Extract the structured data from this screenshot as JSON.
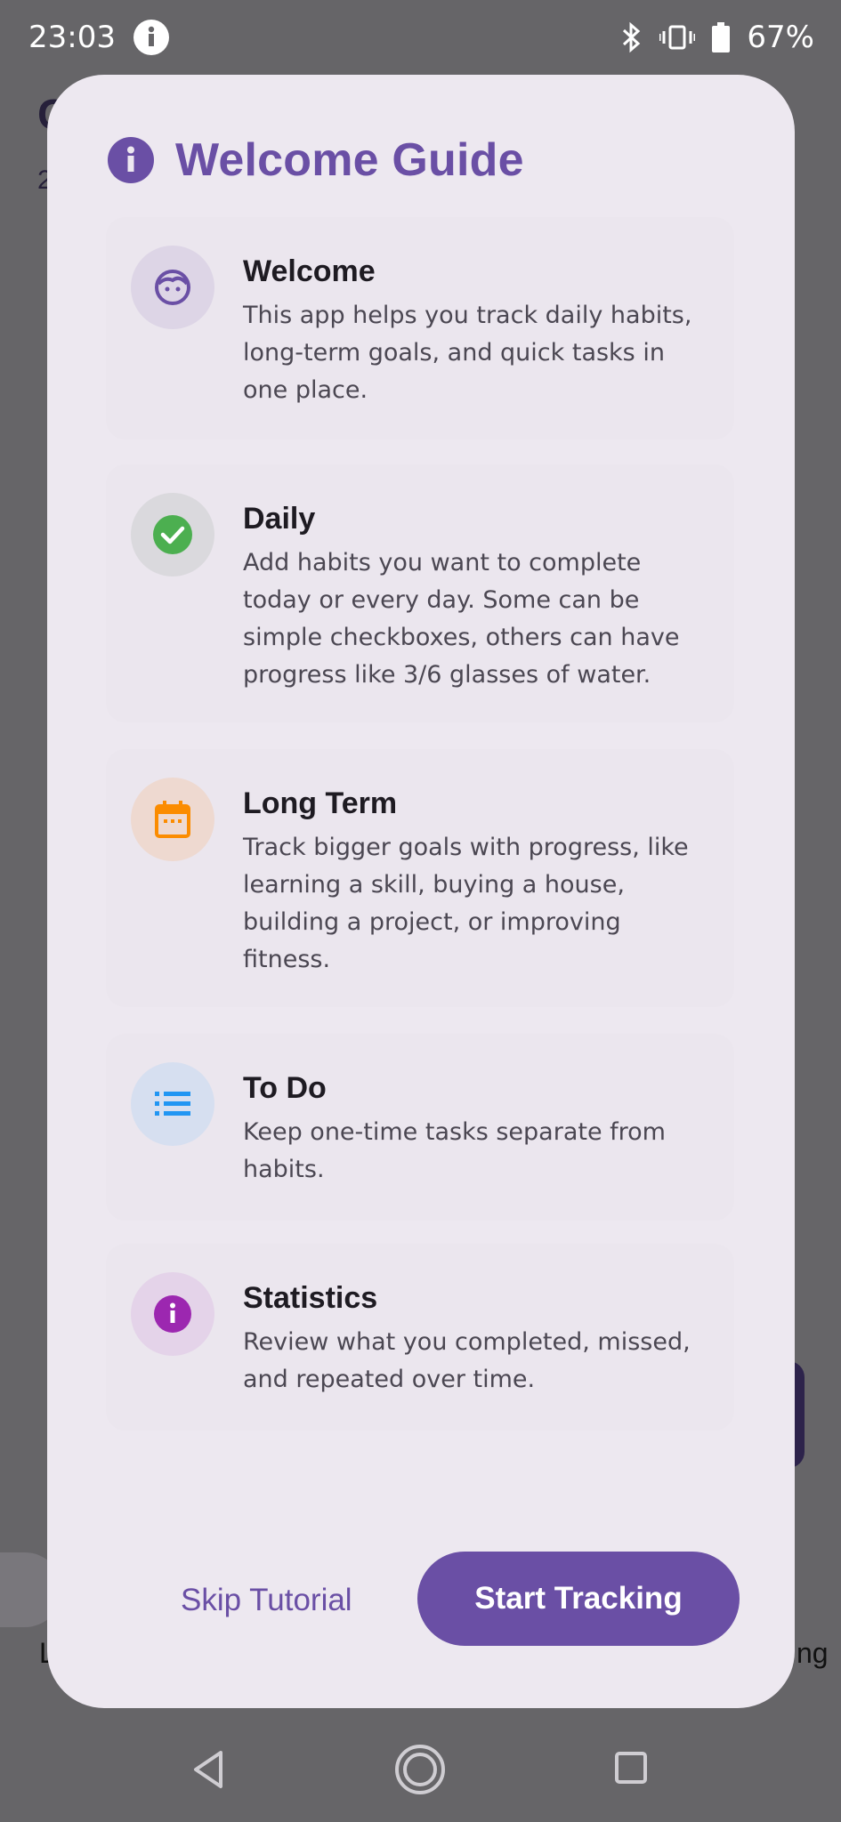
{
  "status_bar": {
    "time": "23:03",
    "battery_percent": "67%",
    "icons": [
      "info-icon",
      "bluetooth-icon",
      "vibrate-icon",
      "battery-icon"
    ]
  },
  "dialog": {
    "title": "Welcome Guide",
    "title_icon": "info-icon",
    "items": [
      {
        "title": "Welcome",
        "description": "This app helps you track daily habits, long-term goals, and quick tasks in one place.",
        "icon": "face-icon",
        "color": "#6a4fa5"
      },
      {
        "title": "Daily",
        "description": "Add habits you want to complete today or every day. Some can be simple checkboxes, others can have progress like 3/6 glasses of water.",
        "icon": "check-circle-icon",
        "color": "#4caf50"
      },
      {
        "title": "Long Term",
        "description": "Track bigger goals with progress, like learning a skill, buying a house, building a project, or improving fitness.",
        "icon": "calendar-icon",
        "color": "#fb8c00"
      },
      {
        "title": "To Do",
        "description": "Keep one-time tasks separate from habits.",
        "icon": "list-icon",
        "color": "#2196f3"
      },
      {
        "title": "Statistics",
        "description": "Review what you completed, missed, and repeated over time.",
        "icon": "info-icon",
        "color": "#9c27b0"
      }
    ],
    "skip_label": "Skip Tutorial",
    "start_label": "Start Tracking"
  },
  "background": {
    "peek_left_top": "C",
    "peek_left_sub": "2",
    "peek_left_bottom": "L",
    "peek_right_bottom": "ng"
  },
  "nav_bar": {
    "icons": [
      "back-icon",
      "home-icon",
      "recents-icon"
    ]
  },
  "colors": {
    "accent": "#6a4fa5",
    "dialog_bg": "#ede8f0",
    "scrim": "#666568"
  }
}
